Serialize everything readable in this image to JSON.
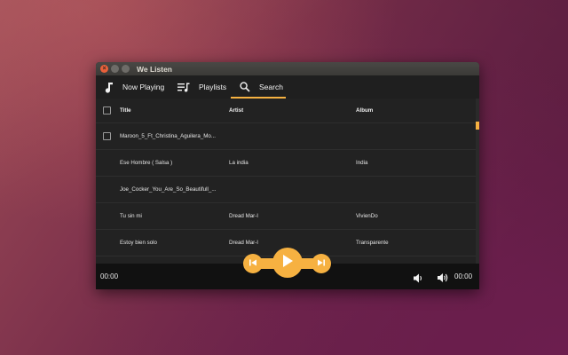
{
  "window": {
    "title": "We Listen"
  },
  "nav": {
    "tabs": [
      {
        "label": "Now Playing",
        "icon": "music-note-icon"
      },
      {
        "label": "Playlists",
        "icon": "playlist-icon"
      },
      {
        "label": "Search",
        "icon": "search-icon",
        "active": true
      }
    ]
  },
  "table": {
    "headers": {
      "title": "Title",
      "artist": "Artist",
      "album": "Album"
    },
    "rows": [
      {
        "title": "Maroon_5_Ft_Christina_Aguilera_Mo...",
        "artist": "",
        "album": ""
      },
      {
        "title": "Ese Hombre ( Salsa )",
        "artist": "La india",
        "album": "India"
      },
      {
        "title": "Joe_Cocker_You_Are_So_Beautifull_...",
        "artist": "",
        "album": ""
      },
      {
        "title": "Tu sin mi",
        "artist": "Dread Mar-I",
        "album": "VivienDo"
      },
      {
        "title": "Estoy bien solo",
        "artist": "Dread Mar-I",
        "album": "Transparente"
      }
    ]
  },
  "player": {
    "elapsed": "00:00",
    "duration": "00:00"
  },
  "colors": {
    "accent": "#f6b141",
    "window_bg": "#1f1f1f",
    "player_bg": "#111111",
    "close_button": "#e8603a"
  }
}
